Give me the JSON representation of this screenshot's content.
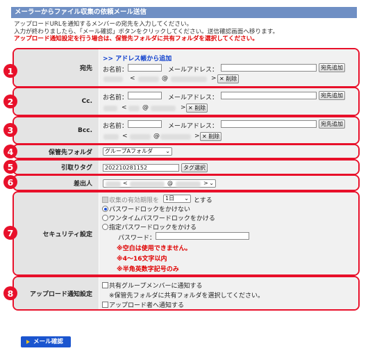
{
  "header": {
    "title": "メーラーからファイル収集の依頼メール送信"
  },
  "intro": {
    "line1": "アップロードURLを通知するメンバーの宛先を入力してください。",
    "line2": "入力が終わりましたら、「メール確認」ボタンをクリックしてください。送信確認画面へ移ります。",
    "warning": "アップロード通知設定を行う場合は、保管先フォルダに共有フォルダを選択してください。"
  },
  "badges": [
    "1",
    "2",
    "3",
    "4",
    "5",
    "6",
    "7",
    "8"
  ],
  "to": {
    "label": "宛先",
    "address_book_link": ">> アドレス帳から追加",
    "name_label": "お名前：",
    "email_label": "メールアドレス：",
    "add_button": "宛先追加",
    "recipient": {
      "lt": "<",
      "at": "@",
      "gt": ">",
      "delete_label": "削除"
    }
  },
  "cc": {
    "label": "Cc.",
    "name_label": "お名前：",
    "email_label": "メールアドレス：",
    "add_button": "宛先追加",
    "recipient": {
      "lt": "<",
      "at": "@",
      "gt": ">",
      "delete_label": "削除"
    }
  },
  "bcc": {
    "label": "Bcc.",
    "name_label": "お名前：",
    "email_label": "メールアドレス：",
    "add_button": "宛先追加",
    "recipient": {
      "lt": "<",
      "at": "@",
      "gt": ">",
      "delete_label": "削除"
    }
  },
  "folder": {
    "label": "保管先フォルダ",
    "selected": "グループAフォルダ"
  },
  "tag": {
    "label": "引取りタグ",
    "value": "202210281152",
    "button": "タグ選択"
  },
  "sender": {
    "label": "差出人",
    "lt": "<",
    "at": "@",
    "gt": ">"
  },
  "security": {
    "label": "セキュリティ設定",
    "expiry_prefix": "収集の有効期限を",
    "expiry_value": "1日",
    "expiry_suffix": "とする",
    "opt_none": "パスワードロックをかけない",
    "opt_onetime": "ワンタイムパスワードロックをかける",
    "opt_specified": "指定パスワードロックをかける",
    "password_label": "パスワード：",
    "note1": "※空白は使用できません。",
    "note2": "※4～16文字以内",
    "note3": "※半角英数字記号のみ"
  },
  "upload": {
    "label": "アップロード通知設定",
    "opt_group": "共有グループメンバーに通知する",
    "note": "※保管先フォルダに共有フォルダを選択してください。",
    "opt_uploader": "アップロード者へ通知する"
  },
  "confirm_button": "メール確認"
}
